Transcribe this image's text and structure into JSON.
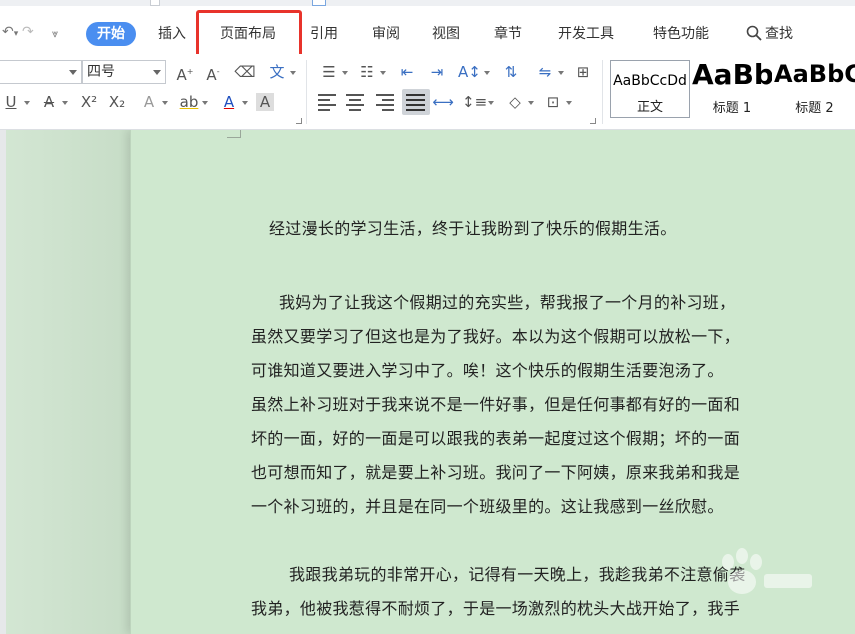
{
  "ribbon": {
    "tabs": [
      {
        "label": "开始",
        "active": true
      },
      {
        "label": "插入"
      },
      {
        "label": "页面布局",
        "highlighted": true
      },
      {
        "label": "引用"
      },
      {
        "label": "审阅"
      },
      {
        "label": "视图"
      },
      {
        "label": "章节"
      },
      {
        "label": "开发工具"
      },
      {
        "label": "特色功能"
      },
      {
        "label": "查找"
      }
    ],
    "highlight_color": "#e8332b",
    "active_color": "#4a8ef0"
  },
  "toolbar": {
    "font_size": "四号",
    "styles": [
      {
        "sample": "AaBbCcDd",
        "name": "正文"
      },
      {
        "sample": "AaBb",
        "name": "标题 1"
      },
      {
        "sample": "AaBbC",
        "name": "标题 2"
      }
    ]
  },
  "document": {
    "background": "#cfe8cf",
    "paragraphs": [
      [
        "经过漫长的学习生活，终于让我盼到了快乐的假期生活。"
      ],
      [
        "我妈为了让我这个假期过的充实些，帮我报了一个月的补习班，",
        "虽然又要学习了但这也是为了我好。本以为这个假期可以放松一下，",
        "可谁知道又要进入学习中了。唉！这个快乐的假期生活要泡汤了。",
        "虽然上补习班对于我来说不是一件好事，但是任何事都有好的一面和",
        "坏的一面，好的一面是可以跟我的表弟一起度过这个假期；坏的一面",
        "也可想而知了，就是要上补习班。我问了一下阿姨，原来我弟和我是",
        "一个补习班的，并且是在同一个班级里的。这让我感到一丝欣慰。"
      ],
      [
        "我跟我弟玩的非常开心，记得有一天晚上，我趁我弟不注意偷袭",
        "我弟，他被我惹得不耐烦了，于是一场激烈的枕头大战开始了，我手"
      ]
    ]
  }
}
